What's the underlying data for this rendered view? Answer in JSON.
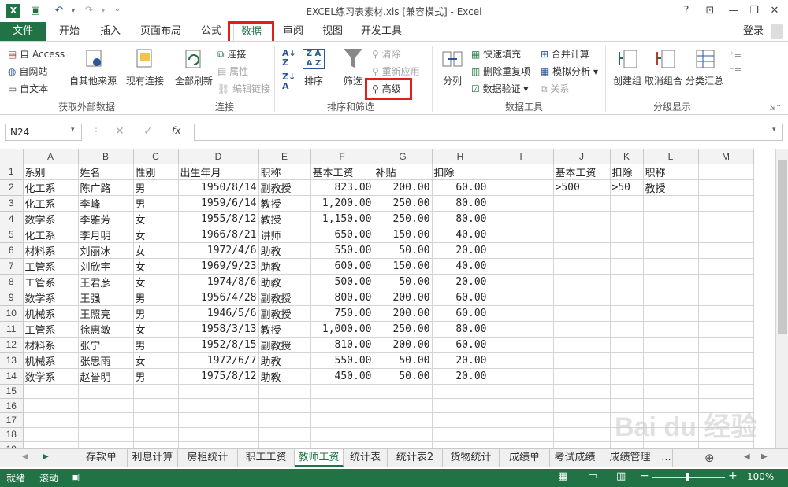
{
  "window": {
    "title": "EXCEL练习表素材.xls  [兼容模式] - Excel",
    "help": "?",
    "login": "登录"
  },
  "tabs": [
    "文件",
    "开始",
    "插入",
    "页面布局",
    "公式",
    "数据",
    "审阅",
    "视图",
    "开发工具"
  ],
  "ribbon": {
    "get_external": {
      "from_access": "自 Access",
      "from_web": "自网站",
      "from_text": "自文本",
      "from_other": "自其他来源",
      "existing": "现有连接",
      "label": "获取外部数据"
    },
    "connections": {
      "refresh_all": "全部刷新",
      "conn": "连接",
      "props": "属性",
      "edit_links": "编辑链接",
      "label": "连接"
    },
    "sort_filter": {
      "sort": "排序",
      "filter": "筛选",
      "clear": "清除",
      "reapply": "重新应用",
      "advanced": "高级",
      "label": "排序和筛选"
    },
    "data_tools": {
      "split": "分列",
      "flash_fill": "快速填充",
      "remove_dup": "删除重复项",
      "validation": "数据验证",
      "consolidate": "合并计算",
      "what_if": "模拟分析",
      "relations": "关系",
      "label": "数据工具"
    },
    "outline": {
      "group": "创建组",
      "ungroup": "取消组合",
      "subtotal": "分类汇总",
      "label": "分级显示"
    }
  },
  "formula_bar": {
    "name_box": "N24",
    "fx": "fx",
    "value": ""
  },
  "columns": [
    "A",
    "B",
    "C",
    "D",
    "E",
    "F",
    "G",
    "H",
    "I",
    "J",
    "K",
    "L",
    "M"
  ],
  "rows": [
    [
      "系别",
      "姓名",
      "性别",
      "出生年月",
      "职称",
      "基本工资",
      "补贴",
      "扣除",
      "",
      "基本工资",
      "扣除",
      "职称",
      ""
    ],
    [
      "化工系",
      "陈广路",
      "男",
      "1950/8/14",
      "副教授",
      "823.00",
      "200.00",
      "60.00",
      "",
      ">500",
      ">50",
      "教授",
      ""
    ],
    [
      "化工系",
      "李峰",
      "男",
      "1959/6/14",
      "教授",
      "1,200.00",
      "250.00",
      "80.00",
      "",
      "",
      "",
      "",
      ""
    ],
    [
      "数学系",
      "李雅芳",
      "女",
      "1955/8/12",
      "教授",
      "1,150.00",
      "250.00",
      "80.00",
      "",
      "",
      "",
      "",
      ""
    ],
    [
      "化工系",
      "李月明",
      "女",
      "1966/8/21",
      "讲师",
      "650.00",
      "150.00",
      "40.00",
      "",
      "",
      "",
      "",
      ""
    ],
    [
      "材料系",
      "刘丽冰",
      "女",
      "1972/4/6",
      "助教",
      "550.00",
      "50.00",
      "20.00",
      "",
      "",
      "",
      "",
      ""
    ],
    [
      "工管系",
      "刘欣宇",
      "女",
      "1969/9/23",
      "助教",
      "600.00",
      "150.00",
      "40.00",
      "",
      "",
      "",
      "",
      ""
    ],
    [
      "工管系",
      "王君彦",
      "女",
      "1974/8/6",
      "助教",
      "500.00",
      "50.00",
      "20.00",
      "",
      "",
      "",
      "",
      ""
    ],
    [
      "数学系",
      "王强",
      "男",
      "1956/4/28",
      "副教授",
      "800.00",
      "200.00",
      "60.00",
      "",
      "",
      "",
      "",
      ""
    ],
    [
      "机械系",
      "王照亮",
      "男",
      "1946/5/6",
      "副教授",
      "750.00",
      "200.00",
      "60.00",
      "",
      "",
      "",
      "",
      ""
    ],
    [
      "工管系",
      "徐惠敏",
      "女",
      "1958/3/13",
      "教授",
      "1,000.00",
      "250.00",
      "80.00",
      "",
      "",
      "",
      "",
      ""
    ],
    [
      "材料系",
      "张宁",
      "男",
      "1952/8/15",
      "副教授",
      "810.00",
      "200.00",
      "60.00",
      "",
      "",
      "",
      "",
      ""
    ],
    [
      "机械系",
      "张思雨",
      "女",
      "1972/6/7",
      "助教",
      "550.00",
      "50.00",
      "20.00",
      "",
      "",
      "",
      "",
      ""
    ],
    [
      "数学系",
      "赵誉明",
      "男",
      "1975/8/12",
      "助教",
      "450.00",
      "50.00",
      "20.00",
      "",
      "",
      "",
      "",
      ""
    ],
    [
      "",
      "",
      "",
      "",
      "",
      "",
      "",
      "",
      "",
      "",
      "",
      "",
      ""
    ],
    [
      "",
      "",
      "",
      "",
      "",
      "",
      "",
      "",
      "",
      "",
      "",
      "",
      ""
    ],
    [
      "",
      "",
      "",
      "",
      "",
      "",
      "",
      "",
      "",
      "",
      "",
      "",
      ""
    ],
    [
      "",
      "",
      "",
      "",
      "",
      "",
      "",
      "",
      "",
      "",
      "",
      "",
      ""
    ],
    [
      "",
      "",
      "",
      "",
      "",
      "",
      "",
      "",
      "",
      "",
      "",
      "",
      ""
    ],
    [
      "",
      "",
      "",
      "",
      "",
      "",
      "",
      "",
      "",
      "",
      "",
      "",
      ""
    ]
  ],
  "sheets": [
    "存款单",
    "利息计算",
    "房租统计",
    "职工工资",
    "教师工资",
    "统计表",
    "统计表2",
    "货物统计",
    "成绩单",
    "考试成绩",
    "成绩管理",
    "..."
  ],
  "active_sheet_index": 4,
  "status": {
    "ready": "就绪",
    "scroll": "滚动",
    "zoom": "100%"
  },
  "watermark": "Bai du 经验",
  "accent_color": "#217346",
  "highlight_color": "#e21d1d"
}
